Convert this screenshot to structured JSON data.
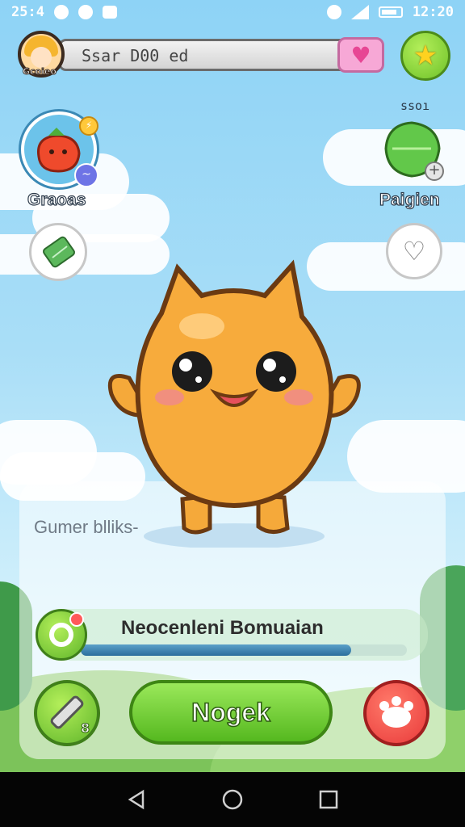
{
  "status_bar": {
    "time_left": "25:4",
    "time_right": "12:20"
  },
  "top_bar": {
    "avatar_label": "Gcoieo",
    "player_name": "Ssar D00 ed",
    "heart_icon": "heart-icon",
    "star_icon": "star-icon"
  },
  "left_items": {
    "item1_label": "Graoas",
    "item1_badge_icon": "lightning-icon",
    "item1_sub_icon": "wave-icon",
    "item2_icon": "ticket-icon"
  },
  "right_items": {
    "item1_count": "ssoı",
    "item1_label": "Paigien",
    "item1_sub_icon": "plus-icon",
    "item2_icon": "heart-outline-icon"
  },
  "panel": {
    "caption": "Gumer blliks-",
    "progress_title": "Neocenleni Bomuaian",
    "progress_value": 0.83
  },
  "bottom_buttons": {
    "left_badge": "8",
    "main_label": "Nogek",
    "left_icon": "pencil-icon",
    "right_icon": "paw-icon"
  },
  "colors": {
    "accent_green": "#6fc22a",
    "accent_red": "#e93a3a",
    "pet_orange": "#f5a93a"
  }
}
